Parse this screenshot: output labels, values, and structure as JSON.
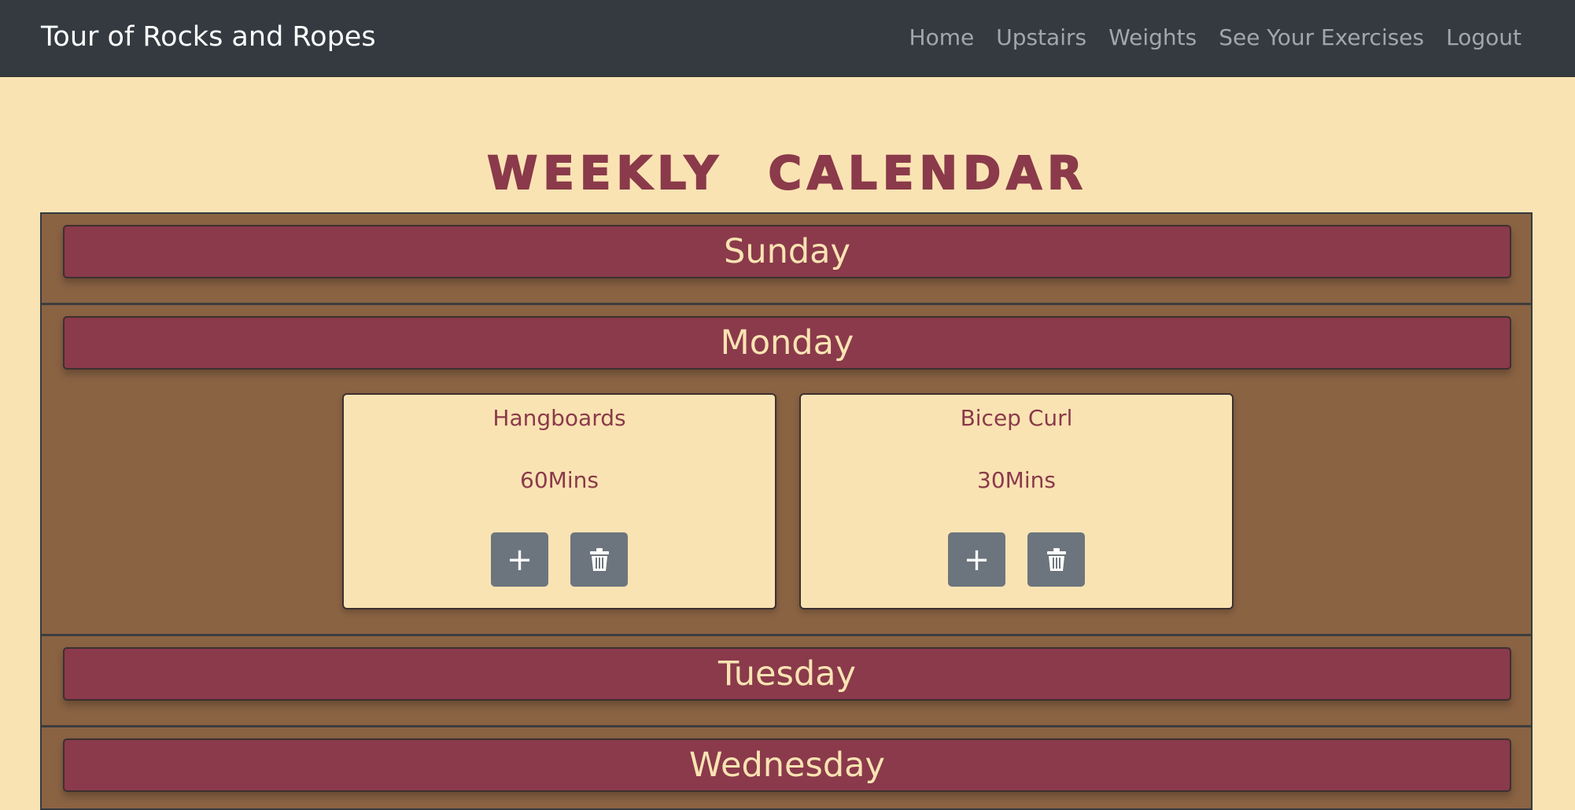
{
  "navbar": {
    "brand": "Tour of Rocks and Ropes",
    "links": [
      "Home",
      "Upstairs",
      "Weights",
      "See Your Exercises",
      "Logout"
    ]
  },
  "page": {
    "title": "WEEKLY CALENDAR"
  },
  "calendar": {
    "days": [
      {
        "name": "Sunday",
        "exercises": []
      },
      {
        "name": "Monday",
        "exercises": [
          {
            "name": "Hangboards",
            "duration": "60Mins",
            "icons": [
              "plus-icon",
              "trash-icon"
            ]
          },
          {
            "name": "Bicep Curl",
            "duration": "30Mins",
            "icons": [
              "plus-icon",
              "trash-icon"
            ]
          }
        ]
      },
      {
        "name": "Tuesday",
        "exercises": []
      },
      {
        "name": "Wednesday",
        "exercises": []
      }
    ]
  },
  "colors": {
    "navbar_bg": "#343a40",
    "page_bg": "#fae3b3",
    "calendar_bg": "#8a6343",
    "day_header_bg": "#8a3a4b",
    "accent_text": "#8a3a4a",
    "button_bg": "#6c757d"
  }
}
